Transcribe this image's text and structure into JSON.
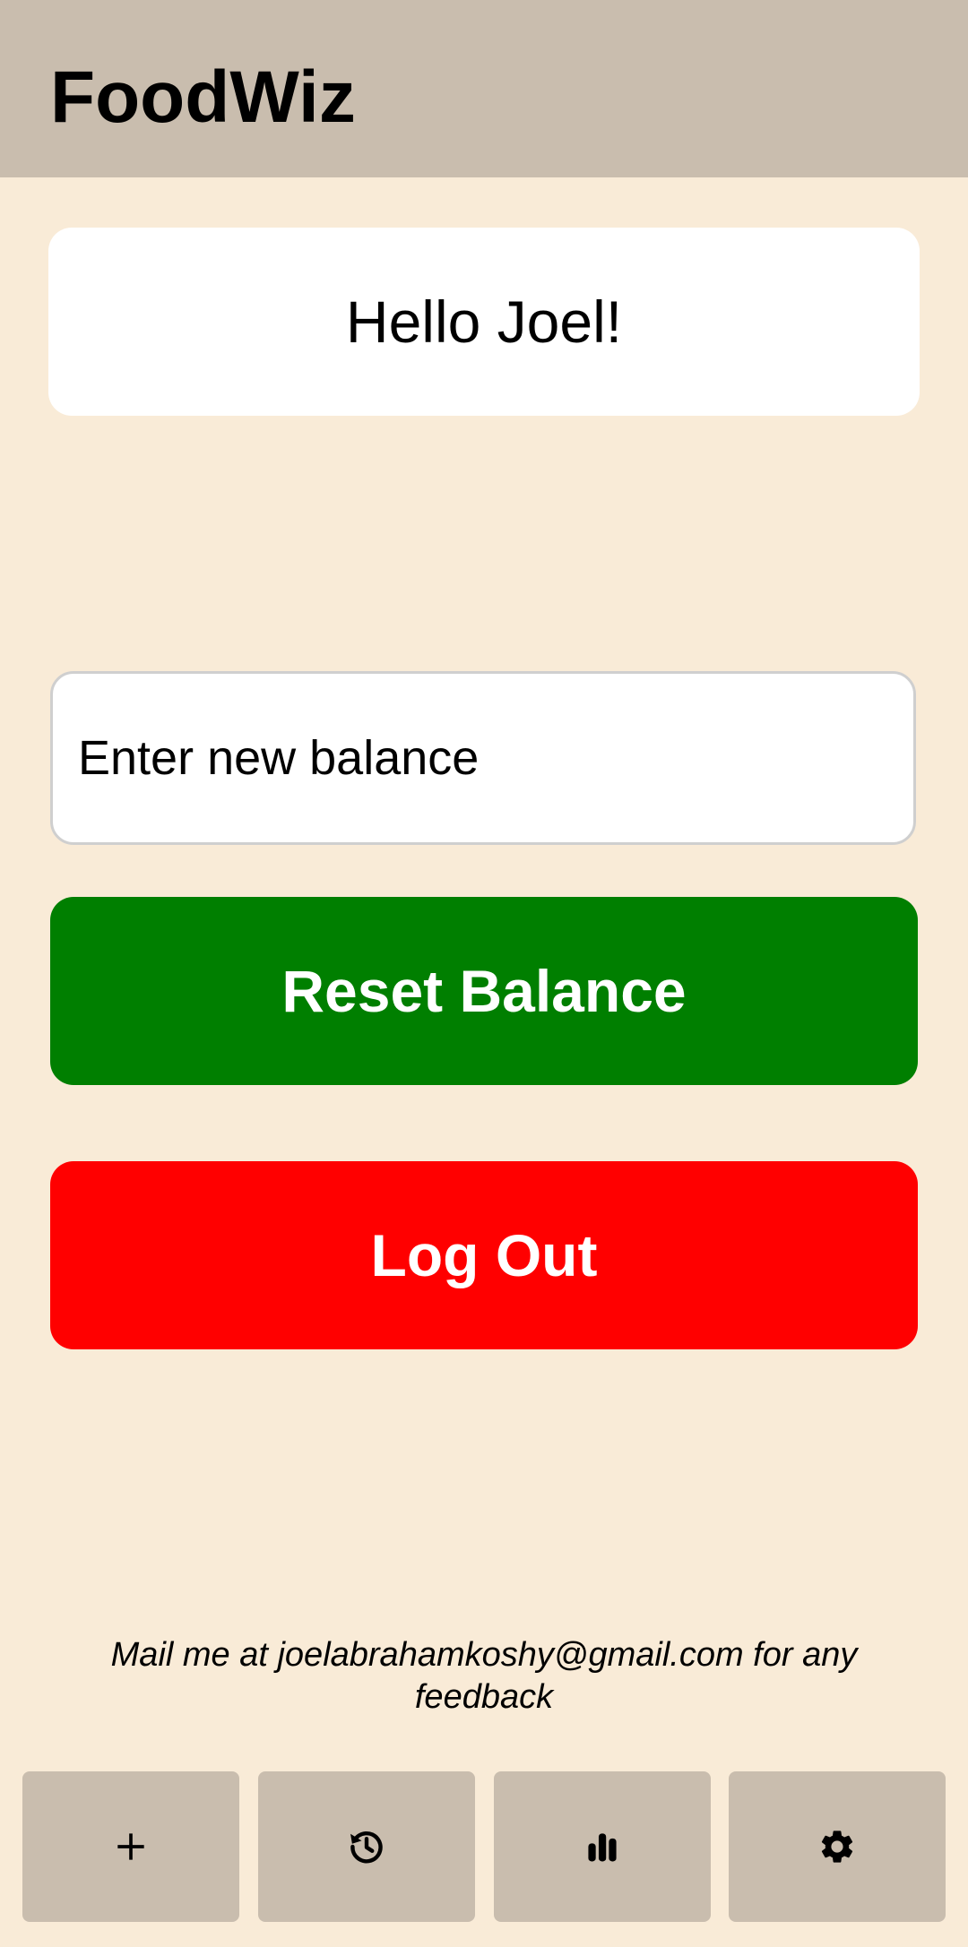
{
  "header": {
    "title": "FoodWiz"
  },
  "greeting": {
    "text": "Hello Joel!"
  },
  "balance": {
    "placeholder": "Enter new balance",
    "value": ""
  },
  "buttons": {
    "reset_label": "Reset Balance",
    "logout_label": "Log Out"
  },
  "footer": {
    "feedback_text": "Mail me at joelabrahamkoshy@gmail.com for any feedback"
  },
  "nav": {
    "items": [
      {
        "icon": "plus-icon"
      },
      {
        "icon": "history-icon"
      },
      {
        "icon": "bar-chart-icon"
      },
      {
        "icon": "gear-icon"
      }
    ]
  },
  "colors": {
    "background": "#f9ebd7",
    "header": "#c9bdae",
    "reset_button": "#007f00",
    "logout_button": "#ff0000"
  }
}
